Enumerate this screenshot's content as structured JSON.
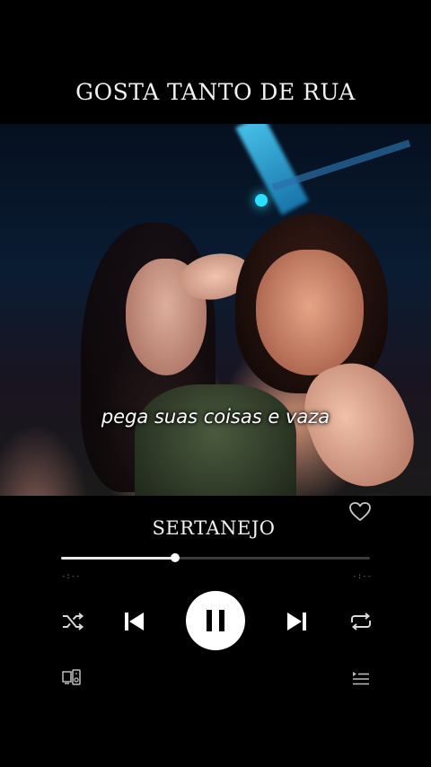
{
  "header": {
    "title": "GOSTA TANTO DE RUA"
  },
  "video": {
    "lyric": "pega suas coisas e vaza"
  },
  "player": {
    "genre": "SERTANEJO",
    "progress": 0.37,
    "time_elapsed": "-:--",
    "time_remaining": "-:--",
    "liked": false,
    "controls": {
      "shuffle_icon": "shuffle-icon",
      "prev_icon": "skip-previous-icon",
      "play_pause_icon": "pause-icon",
      "next_icon": "skip-next-icon",
      "repeat_icon": "repeat-icon",
      "device_icon": "connect-device-icon",
      "queue_icon": "queue-icon"
    }
  }
}
